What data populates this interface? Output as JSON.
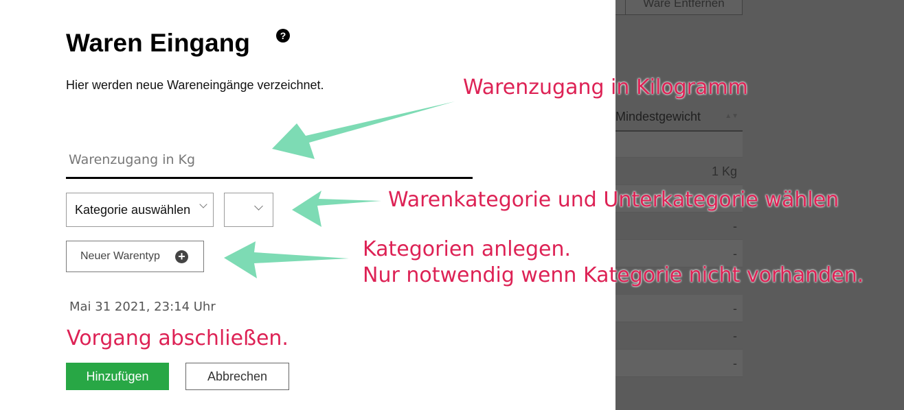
{
  "background": {
    "button_partial": "Ware Entfernen",
    "column_header": "Mindestgewicht",
    "rows": [
      "1 Kg",
      "-",
      "-",
      "",
      "-",
      "-",
      "-"
    ]
  },
  "modal": {
    "title": "Waren Eingang",
    "help_icon": "?",
    "subtitle": "Hier werden neue Wareneingänge verzeichnet.",
    "kg_input": {
      "value": "",
      "placeholder": "Warenzugang in Kg"
    },
    "category_select": "Kategorie auswählen",
    "subcategory_select": "",
    "new_type_button": "Neuer Warentyp",
    "datetime": "Mai 31 2021, 23:14 Uhr",
    "add_button": "Hinzufügen",
    "cancel_button": "Abbrechen"
  },
  "annotations": {
    "kg": "Warenzugang in Kilogramm",
    "category": "Warenkategorie und Unterkategorie wählen",
    "new_type_line1": "Kategorien anlegen.",
    "new_type_line2": "Nur notwendig wenn Kategorie nicht vorhanden.",
    "finish": "Vorgang abschließen."
  },
  "colors": {
    "annotation_text": "#dd2255",
    "arrow": "#7ddbb4",
    "primary_button": "#28a745",
    "backdrop": "#5b5b5b"
  },
  "icons": [
    "help-icon",
    "plus-circle-icon",
    "chevron-down-icon"
  ]
}
